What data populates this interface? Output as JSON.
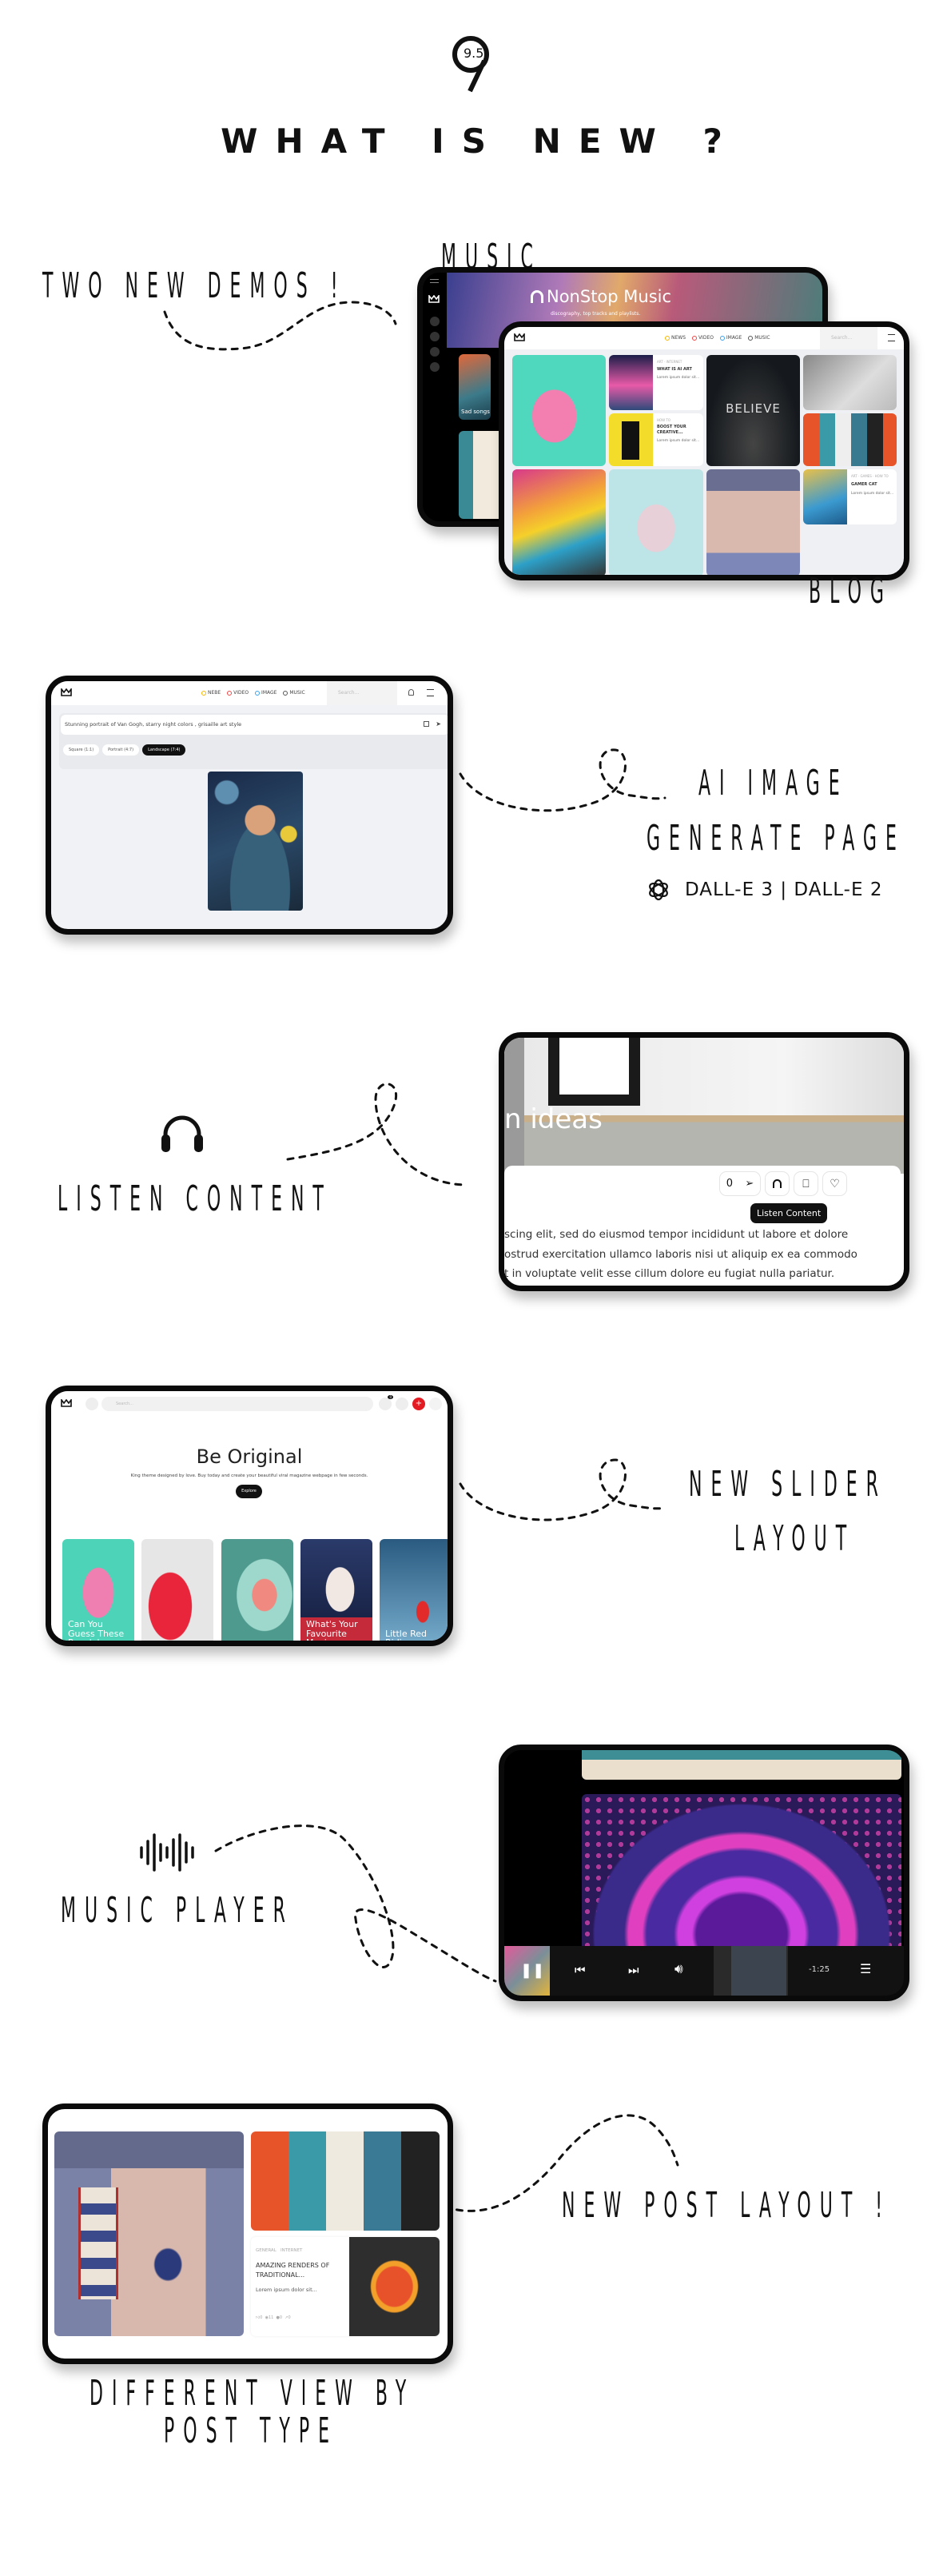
{
  "header": {
    "logo_text": "9.5",
    "title": "WHAT IS NEW ?"
  },
  "sections": {
    "demos": {
      "heading": "TWO NEW DEMOS !",
      "label_music": "MUSIC",
      "label_blog": "BLOG"
    },
    "ai": {
      "line1": "AI IMAGE",
      "line2": "GENERATE PAGE",
      "models": "DALL-E 3 | DALL-E 2",
      "icon": "openai-icon"
    },
    "listen": {
      "heading": "LISTEN CONTENT",
      "icon": "headphones-icon"
    },
    "slider": {
      "line1": "NEW SLIDER",
      "line2": "LAYOUT"
    },
    "player": {
      "heading": "MUSIC PLAYER",
      "icon": "waveform-icon"
    },
    "post": {
      "heading": "NEW POST LAYOUT !",
      "caption1": "DIFFERENT VIEW BY",
      "caption2": "POST TYPE"
    }
  },
  "music_demo": {
    "banner_title": "NonStop Music",
    "banner_subtitle": "discography, top tracks and playlists.",
    "card_label": "Sad songs"
  },
  "blog_demo": {
    "nav": [
      "NEWS",
      "VIDEO",
      "IMAGE",
      "MUSIC"
    ],
    "nav_colors": [
      "#f5b700",
      "#ef4444",
      "#38a3f1",
      "#555555"
    ],
    "search_placeholder": "Search...",
    "cards": [
      {
        "cats": "ART · INTERNET",
        "title": "WHAT IS AI ART",
        "excerpt": "Lorem ipsum dolor sit..."
      },
      {
        "cats": "HOW TO",
        "title": "BOOST YOUR CREATIVE...",
        "excerpt": "Lorem ipsum dolor sit..."
      },
      {
        "cats": "ART · GAMES · HOW TO",
        "title": "GAMER CAT",
        "excerpt": "Lorem ipsum dolor sit..."
      }
    ],
    "believe_text": "BELIEVE"
  },
  "ai_demo": {
    "nav": [
      "NEBE",
      "VIDEO",
      "IMAGE",
      "MUSIC"
    ],
    "search_placeholder": "Search...",
    "prompt": "Stunning portrait of Van Gogh, starry night colors , grisaille art style",
    "ratios": [
      {
        "label": "Square (1:1)",
        "active": false
      },
      {
        "label": "Portrait (4:7)",
        "active": false
      },
      {
        "label": "Landscape (7:4)",
        "active": true
      }
    ]
  },
  "listen_demo": {
    "heading_fragment": "n ideas",
    "share_count": "0",
    "tooltip": "Listen Content",
    "body_lines": [
      "scing elit, sed do eiusmod tempor incididunt ut labore et dolore",
      "ostrud exercitation ullamco laboris nisi ut aliquip ex ea commodo",
      "t in voluptate velit esse cillum dolore eu fugiat nulla pariatur."
    ]
  },
  "slider_demo": {
    "search_placeholder": "Search...",
    "bookmark_count": "0",
    "hero_title": "Be Original",
    "hero_subtitle": "King theme designed by love. Buy today and create your beautiful viral magazine webpage in few seconds.",
    "explore_label": "Explore",
    "slides": [
      "Can You Guess These People's",
      "",
      "",
      "What's Your Favourite Movie",
      "Little Red Riding"
    ]
  },
  "player_demo": {
    "time_remaining": "-1:25"
  },
  "post_demo": {
    "cats": [
      "GENERAL",
      "INTERNET"
    ],
    "title": "AMAZING RENDERS OF TRADITIONAL...",
    "excerpt": "Lorem ipsum dolor sit...",
    "stats": [
      "0",
      "11",
      "0",
      "0"
    ]
  },
  "colors": {
    "accent_red": "#e31b23",
    "frame": "#0a0a0a",
    "dark": "#111111"
  }
}
